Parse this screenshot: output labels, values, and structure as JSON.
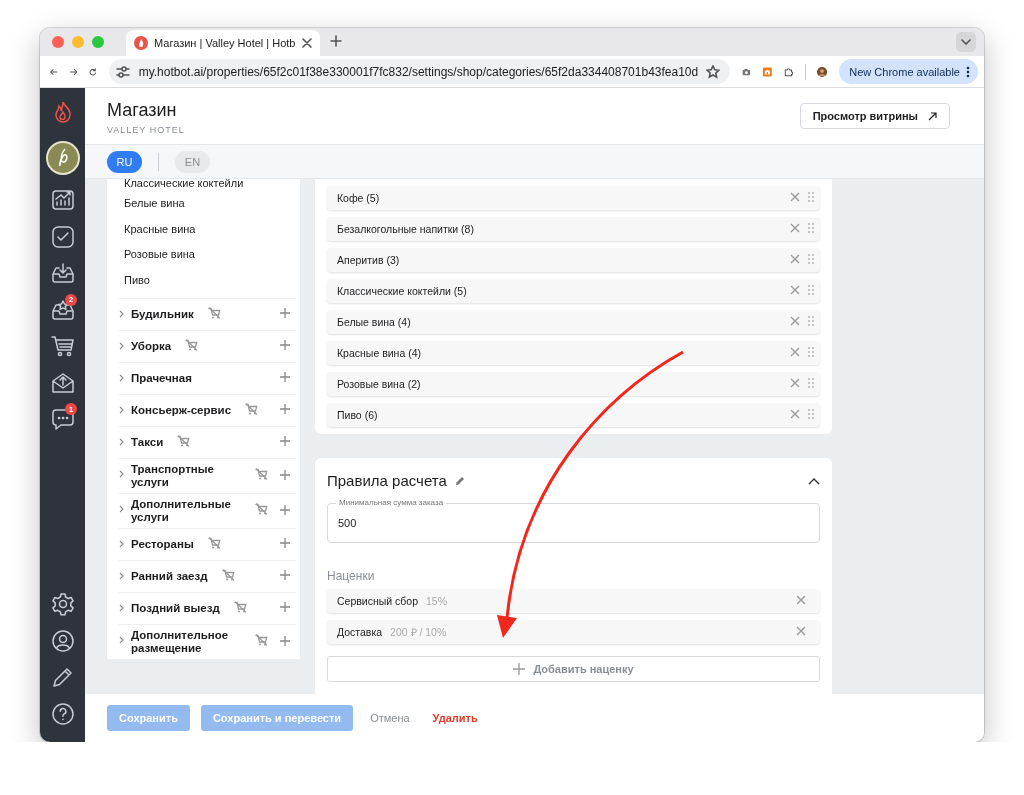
{
  "browser": {
    "tab_title": "Магазин | Valley Hotel | Hotb",
    "url": "my.hotbot.ai/properties/65f2c01f38e330001f7fc832/settings/shop/categories/65f2da334408701b43fea10d",
    "update_button": "New Chrome available"
  },
  "sidebar": {
    "items": [
      {
        "kind": "logo"
      },
      {
        "kind": "avatar"
      },
      {
        "kind": "chart"
      },
      {
        "kind": "tasks"
      },
      {
        "kind": "inbox"
      },
      {
        "kind": "reviews",
        "badge": "2"
      },
      {
        "kind": "shop"
      },
      {
        "kind": "mail"
      },
      {
        "kind": "chat",
        "badge": "1"
      }
    ],
    "bottom_items": [
      {
        "kind": "settings"
      },
      {
        "kind": "profile"
      },
      {
        "kind": "edit"
      },
      {
        "kind": "help"
      }
    ]
  },
  "header": {
    "title": "Магазин",
    "subtitle": "VALLEY HOTEL",
    "storefront_button": "Просмотр витрины"
  },
  "languages": [
    {
      "label": "RU",
      "selected": true
    },
    {
      "label": "EN",
      "selected": false
    }
  ],
  "category_tree": {
    "visible_subitems": [
      "Классические коктейли",
      "Белые вина",
      "Красные вина",
      "Розовые вина",
      "Пиво"
    ],
    "categories": [
      {
        "name": "Будильник",
        "cart_off": true
      },
      {
        "name": "Уборка",
        "cart_off": true
      },
      {
        "name": "Прачечная",
        "cart_off": false
      },
      {
        "name": "Консьерж-сервис",
        "cart_off": true
      },
      {
        "name": "Такси",
        "cart_off": true
      },
      {
        "name": "Транспортные услуги",
        "cart_off": true
      },
      {
        "name": "Дополнительные услуги",
        "cart_off": true
      },
      {
        "name": "Рестораны",
        "cart_off": true
      },
      {
        "name": "Ранний заезд",
        "cart_off": true
      },
      {
        "name": "Поздний выезд",
        "cart_off": true
      },
      {
        "name": "Дополнительное размещение",
        "cart_off": true
      }
    ]
  },
  "subcategories": [
    "Кофе (5)",
    "Безалкогольные напитки (8)",
    "Аперитив (3)",
    "Классические коктейли (5)",
    "Белые вина (4)",
    "Красные вина (4)",
    "Розовые вина (2)",
    "Пиво (6)"
  ],
  "pricing_rules": {
    "title": "Правила расчета",
    "expanded": true,
    "min_order": {
      "label": "Минимальная сумма заказа",
      "value": "500"
    },
    "markups_label": "Наценки",
    "markups": [
      {
        "name": "Сервисный сбор",
        "value": "15%"
      },
      {
        "name": "Доставка",
        "value": "200 ₽ / 10%"
      }
    ],
    "add_button": "Добавить наценку"
  },
  "footer": {
    "buttons": [
      {
        "kind": "primary",
        "label": "Сохранить"
      },
      {
        "kind": "primary",
        "label": "Сохранить и перевести"
      },
      {
        "kind": "text",
        "label": "Отмена"
      },
      {
        "kind": "danger",
        "label": "Удалить"
      }
    ]
  },
  "annotation": {
    "kind": "arrow"
  }
}
